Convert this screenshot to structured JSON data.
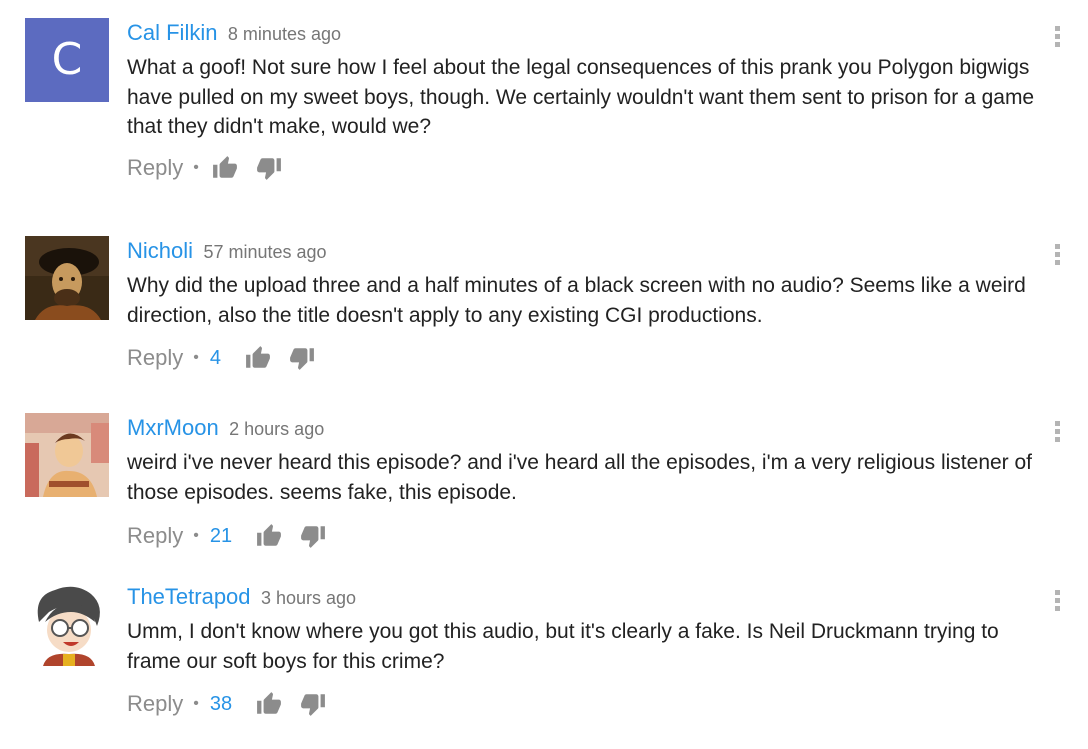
{
  "comments": [
    {
      "author": "Cal Filkin",
      "time": "8 minutes ago",
      "avatar_letter": "C",
      "avatar_color": "#5c6bc0",
      "text": "What a goof! Not sure how I feel about the legal consequences of this prank you Polygon bigwigs have pulled on my sweet boys, though. We certainly wouldn't want them sent to prison for a game that they didn't make, would we?",
      "reply_label": "Reply",
      "likes": ""
    },
    {
      "author": "Nicholi",
      "time": "57 minutes ago",
      "text": "Why did the upload three and a half minutes of a black screen with no audio? Seems like a weird direction, also the title doesn't apply to any existing CGI productions.",
      "reply_label": "Reply",
      "likes": "4"
    },
    {
      "author": "MxrMoon",
      "time": "2 hours ago",
      "text": "weird i've never heard this episode? and i've heard all the episodes, i'm a very religious listener of those episodes. seems fake, this episode.",
      "reply_label": "Reply",
      "likes": "21"
    },
    {
      "author": "TheTetrapod",
      "time": "3 hours ago",
      "text": "Umm, I don't know where you got this audio, but it's clearly a fake. Is Neil Druckmann trying to frame our soft boys for this crime?",
      "reply_label": "Reply",
      "likes": "38"
    }
  ],
  "colors": {
    "author": "#2793e6",
    "likes": "#2793e6",
    "meta": "#767676",
    "reply": "#8c8c8c",
    "icon": "#8c8c8c"
  },
  "icons": {
    "like": "thumbs-up-icon",
    "dislike": "thumbs-down-icon",
    "menu": "vertical-dots-icon"
  }
}
